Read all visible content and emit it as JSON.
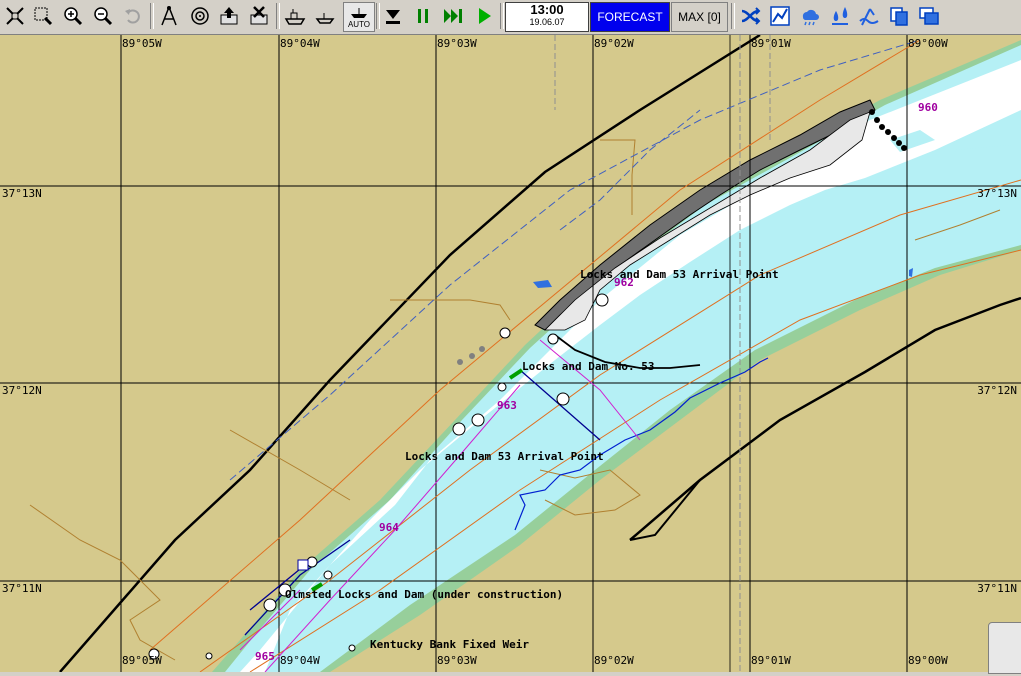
{
  "toolbar": {
    "buttons": [
      {
        "name": "fit-chart-icon"
      },
      {
        "name": "zoom-window-icon"
      },
      {
        "name": "zoom-in-icon"
      },
      {
        "name": "zoom-out-icon"
      },
      {
        "name": "undo-icon"
      },
      {
        "name": "compass-icon"
      },
      {
        "name": "target-icon"
      },
      {
        "name": "export-icon"
      },
      {
        "name": "delete-icon"
      },
      {
        "name": "ship-icon"
      },
      {
        "name": "ship-small-icon"
      },
      {
        "name": "auto-ship-icon",
        "label": "AUTO"
      },
      {
        "name": "step-down-icon"
      },
      {
        "name": "pause-icon"
      },
      {
        "name": "fast-forward-icon"
      },
      {
        "name": "play-icon"
      }
    ],
    "clock": {
      "time": "13:00",
      "date": "19.06.07"
    },
    "forecast_label": "FORECAST",
    "max_label": "MAX [0]",
    "right_buttons": [
      {
        "name": "shuffle-icon"
      },
      {
        "name": "chart-icon"
      },
      {
        "name": "weather-icon"
      },
      {
        "name": "drops-icon"
      },
      {
        "name": "tides-icon"
      },
      {
        "name": "copy-icon"
      },
      {
        "name": "windows-icon"
      }
    ]
  },
  "map": {
    "colors": {
      "land": "#d5c98c",
      "deep": "#ffffff",
      "shallow": "#b5f0f5",
      "drying": "#97cf9b",
      "depth_label": "#a000a0",
      "grid": "#000000"
    },
    "lon_labels": [
      "89°05W",
      "89°04W",
      "89°03W",
      "89°02W",
      "89°01W",
      "89°00W"
    ],
    "lat_labels": [
      "37°13N",
      "37°12N",
      "37°11N"
    ],
    "mile_markers": [
      "960",
      "962",
      "963",
      "964",
      "965"
    ],
    "labels": {
      "arrival_top": "Locks and Dam 53 Arrival Point",
      "lock_dam": "Locks and Dam No. 53",
      "arrival_bottom": "Locks and Dam 53 Arrival Point",
      "olmsted": "Olmsted Locks and Dam (under construction)",
      "weir": "Kentucky Bank Fixed Weir"
    }
  }
}
